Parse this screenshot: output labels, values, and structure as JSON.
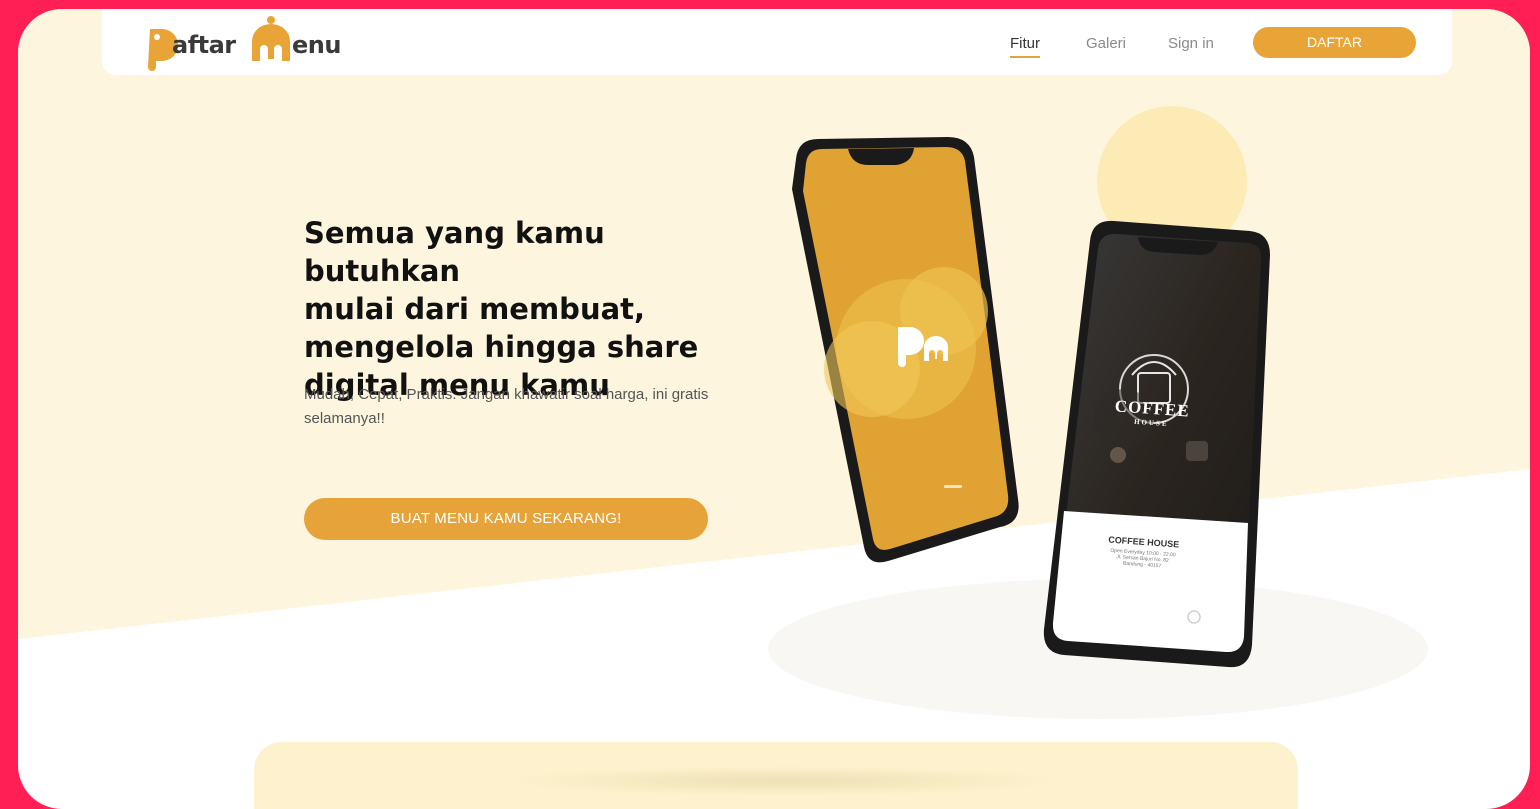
{
  "brand": {
    "logo_text_1": "aftar",
    "logo_text_2": "enu",
    "accent_color": "#e8a436",
    "frame_color": "#ff1f55"
  },
  "nav": {
    "links": [
      {
        "label": "Fitur",
        "active": true
      },
      {
        "label": "Galeri",
        "active": false
      },
      {
        "label": "Sign in",
        "active": false
      }
    ],
    "cta_label": "DAFTAR"
  },
  "hero": {
    "headline_lines": [
      "Semua yang kamu butuhkan",
      "mulai dari membuat,",
      "mengelola hingga share",
      "digital menu kamu"
    ],
    "subtext": "Mudah, Cepat, Praktis. Jangan khawatir soal harga, ini gratis selamanya!!",
    "cta_label": "BUAT MENU KAMU SEKARANG!"
  },
  "phone_front": {
    "brand_title": "COFFEE",
    "brand_subtitle": "HOUSE",
    "card_title": "COFFEE HOUSE",
    "card_lines": [
      "Open Everyday 10:00 - 22:00",
      "Jl. Sersan Bajuri No. 82",
      "Bandung - 40157"
    ]
  },
  "icons": [
    "logo-icon",
    "instagram-icon"
  ]
}
